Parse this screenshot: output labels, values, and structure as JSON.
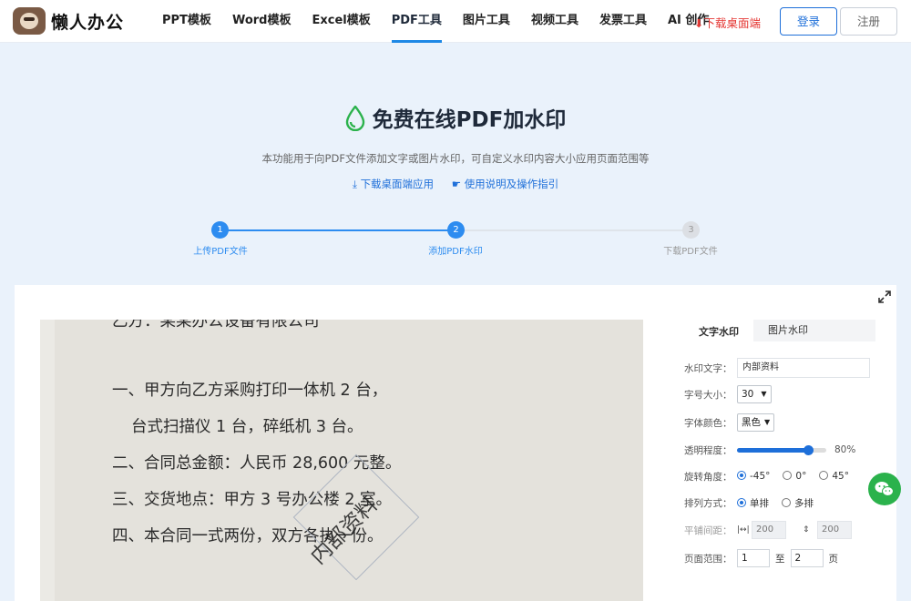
{
  "header": {
    "brand": "懒人办公",
    "nav": [
      "PPT模板",
      "Word模板",
      "Excel模板",
      "PDF工具",
      "图片工具",
      "视频工具",
      "发票工具",
      "AI 创作"
    ],
    "active_nav": "PDF工具",
    "download_label": "下载桌面端",
    "login_label": "登录",
    "register_label": "注册"
  },
  "hero": {
    "title": "免费在线PDF加水印",
    "description": "本功能用于向PDF文件添加文字或图片水印，可自定义水印内容大小应用页面范围等",
    "link_download": "下载桌面端应用",
    "link_guide": "使用说明及操作指引"
  },
  "steps": [
    {
      "num": "1",
      "label": "上传PDF文件",
      "state": "done"
    },
    {
      "num": "2",
      "label": "添加PDF水印",
      "state": "active"
    },
    {
      "num": "3",
      "label": "下载PDF文件",
      "state": "pending"
    }
  ],
  "document": {
    "lines": [
      "乙方：某某办公设备有限公司",
      "一、甲方向乙方采购打印一体机 2 台，",
      "台式扫描仪 1 台，碎纸机 3 台。",
      "二、合同总金额：人民币 28,600 元整。",
      "三、交货地点：甲方 3 号办公楼 2 室。",
      "四、本合同一式两份，双方各执一份。"
    ],
    "watermark_text": "内部资料"
  },
  "panel": {
    "tabs": [
      "文字水印",
      "图片水印"
    ],
    "active_tab": "文字水印",
    "text_label": "水印文字：",
    "text_value": "内部资料",
    "size_label": "字号大小：",
    "size_value": "30",
    "color_label": "字体颜色：",
    "color_value": "黑色",
    "opacity_label": "透明程度：",
    "opacity_value": "80%",
    "opacity_fraction": 0.8,
    "rotation_label": "旋转角度：",
    "rotation_options": [
      "-45°",
      "0°",
      "45°"
    ],
    "rotation_selected": "-45°",
    "layout_label": "排列方式：",
    "layout_options": [
      "单排",
      "多排"
    ],
    "layout_selected": "单排",
    "spacing_label": "平铺间距：",
    "spacing_h": "200",
    "spacing_v": "200",
    "page_label": "页面范围：",
    "page_from": "1",
    "page_to_label": "至",
    "page_to": "2",
    "page_unit": "页"
  },
  "colors": {
    "accent": "#1e6fd9",
    "step_active": "#2d8cf0",
    "download_red": "#e53935",
    "wechat_green": "#2bb24c"
  }
}
